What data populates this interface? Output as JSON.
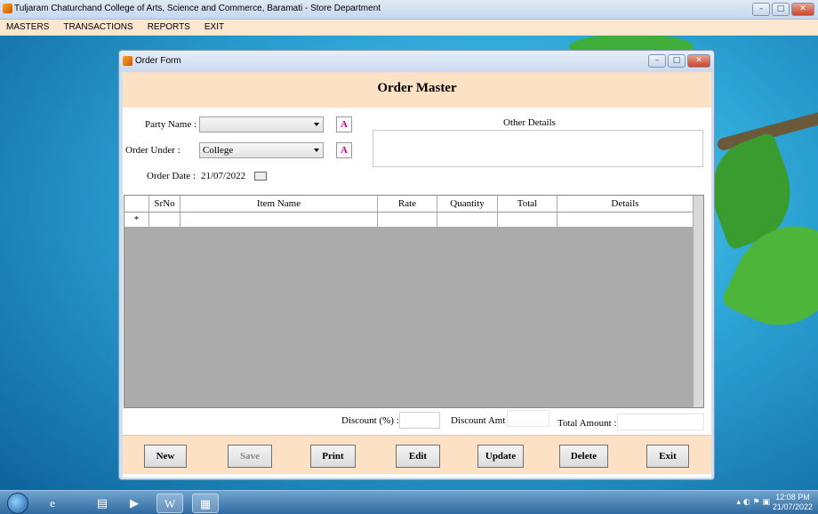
{
  "app": {
    "title": "Tuljaram Chaturchand College of Arts, Science and Commerce, Baramati - Store Department",
    "window_buttons": [
      "–",
      "□",
      "✕"
    ]
  },
  "menu": {
    "items": [
      "MASTERS",
      "TRANSACTIONS",
      "REPORTS",
      "EXIT"
    ]
  },
  "order_form": {
    "window_title": "Order Form",
    "heading": "Order Master",
    "party_name_label": "Party Name :",
    "party_name_value": "",
    "order_under_label": "Order Under :",
    "order_under_value": "College",
    "add_button_label": "A",
    "order_date_label": "Order Date :",
    "order_date_value": "21/07/2022",
    "other_details_label": "Other Details",
    "grid": {
      "columns": [
        "SrNo",
        "Item Name",
        "Rate",
        "Quantity",
        "Total",
        "Details"
      ],
      "new_row_marker": "*"
    },
    "discount_pct_label": "Discount (%) :",
    "discount_amt_label": "Discount Amt :",
    "total_amount_label": "Total Amount :",
    "buttons": {
      "new": "New",
      "save": "Save",
      "print": "Print",
      "edit": "Edit",
      "update": "Update",
      "delete": "Delete",
      "exit": "Exit"
    }
  },
  "taskbar": {
    "time": "12:08 PM",
    "date": "21/07/2022"
  }
}
